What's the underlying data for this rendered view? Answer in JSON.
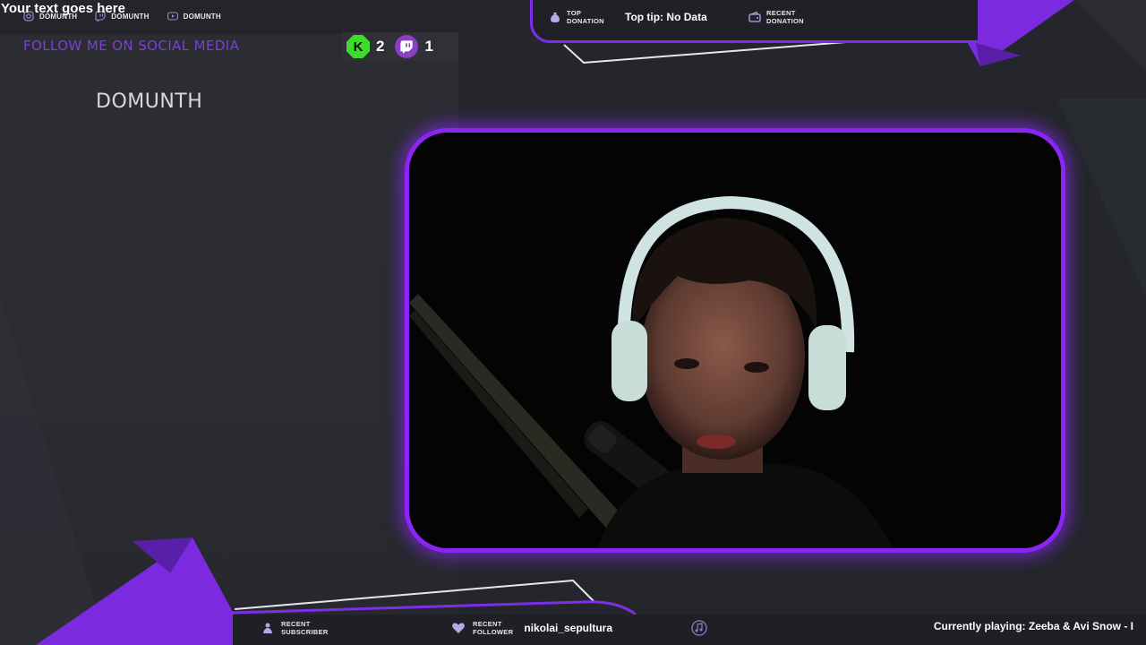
{
  "header": {
    "custom_text": "Your text goes here",
    "socials": [
      {
        "icon": "instagram-icon",
        "name": "DOMUNTH"
      },
      {
        "icon": "twitch-icon",
        "name": "DOMUNTH"
      },
      {
        "icon": "youtube-icon",
        "name": "DOMUNTH"
      }
    ],
    "follow_title": "FOLLOW ME ON SOCIAL MEDIA",
    "streamer_name": "DOMUNTH"
  },
  "viewers": {
    "kick": {
      "icon": "kick-icon",
      "count": "2"
    },
    "twitch": {
      "icon": "twitch-icon",
      "count": "1"
    }
  },
  "donations": {
    "top_label_line1": "TOP",
    "top_label_line2": "DONATION",
    "top_value": "Top tip: No Data",
    "recent_label_line1": "RECENT",
    "recent_label_line2": "DONATION",
    "recent_value": ""
  },
  "bottom": {
    "subscriber_label_line1": "RECENT",
    "subscriber_label_line2": "SUBSCRIBER",
    "subscriber_value": "",
    "follower_label_line1": "RECENT",
    "follower_label_line2": "FOLLOWER",
    "follower_value": "nikolai_sepultura",
    "music_icon": "music-note-icon",
    "now_playing": "Currently playing: Zeeba & Avi Snow - I"
  },
  "colors": {
    "accent": "#8b25f4",
    "follow_title": "#7a40d6",
    "kick_green": "#3ddc2c",
    "twitch_purple": "#8a3ec4",
    "background": "#25272c"
  }
}
